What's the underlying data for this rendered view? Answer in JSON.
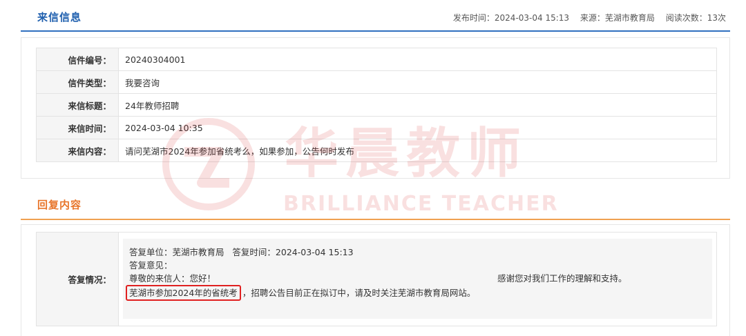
{
  "letter_info": {
    "title": "来信信息",
    "publish_time": "发布时间：2024-03-04 15:13",
    "source": "来源：芜湖市教育局",
    "read_count": "阅读次数：13次",
    "rows": [
      {
        "label": "信件编号：",
        "value": "20240304001"
      },
      {
        "label": "信件类型：",
        "value": "我要咨询"
      },
      {
        "label": "来信标题：",
        "value": "24年教师招聘"
      },
      {
        "label": "来信时间：",
        "value": "2024-03-04 10:35"
      },
      {
        "label": "来信内容：",
        "value": "请问芜湖市2024年参加省统考么，如果参加，公告何时发布"
      }
    ]
  },
  "reply": {
    "title": "回复内容",
    "label": "答复情况：",
    "unit_line": "答复单位：芜湖市教育局   答复时间：2024-03-04 15:13",
    "opinion_label": "答复意见：",
    "greeting": "尊敬的来信人：您好！",
    "thanks": "感谢您对我们工作的理解和支持。",
    "highlight": "芜湖市参加2024年的省统考",
    "rest": "，招聘公告目前正在拟订中，请及时关注芜湖市教育局网站。"
  },
  "watermark": {
    "text": "华晨教师",
    "sub": "BRILLIANCE TEACHER",
    "color": "#d21c1c"
  },
  "colors": {
    "primary_blue": "#1f5fae",
    "accent_orange": "#e8752a",
    "highlight_red": "#e02020"
  }
}
